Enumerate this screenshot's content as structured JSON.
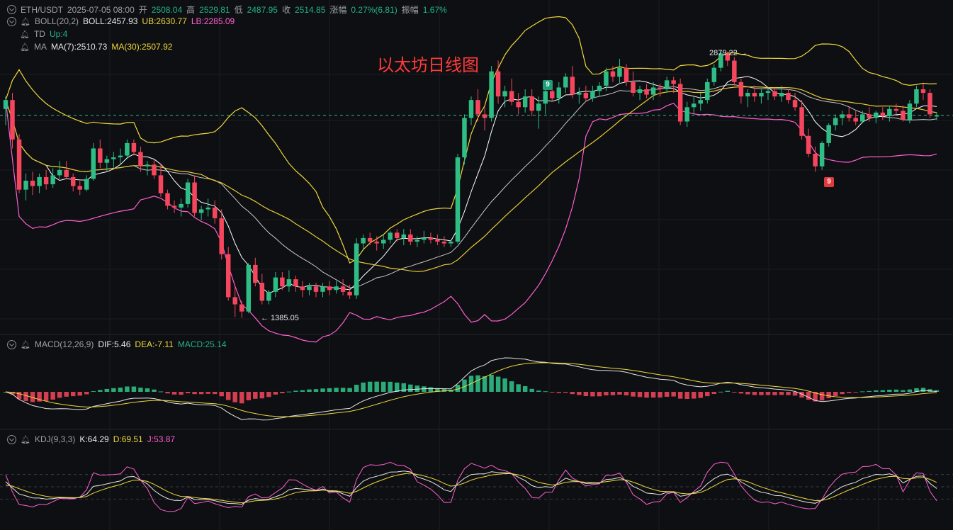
{
  "header": {
    "symbol": "ETH/USDT",
    "datetime": "2025-07-05 08:00",
    "open_label": "开",
    "open": "2508.04",
    "high_label": "高",
    "high": "2529.81",
    "low_label": "低",
    "low": "2487.95",
    "close_label": "收",
    "close": "2514.85",
    "change_label": "涨幅",
    "change": "0.27%(6.81)",
    "amp_label": "振幅",
    "amp": "1.67%"
  },
  "boll": {
    "name": "BOLL(20,2)",
    "mid": "BOLL:2457.93",
    "ub": "UB:2630.77",
    "lb": "LB:2285.09"
  },
  "td": {
    "name": "TD",
    "value": "Up:4"
  },
  "ma": {
    "name": "MA",
    "ma7": "MA(7):2510.73",
    "ma30": "MA(30):2507.92"
  },
  "macd": {
    "name": "MACD(12,26,9)",
    "dif": "DIF:5.46",
    "dea": "DEA:-7.11",
    "macd": "MACD:25.14"
  },
  "kdj": {
    "name": "KDJ(9,3,3)",
    "k": "K:64.29",
    "d": "D:69.51",
    "j": "J:53.87"
  },
  "title": "以太坊日线图",
  "annotations": {
    "high": "2879.22 →",
    "low": "← 1385.05",
    "td_top": "9",
    "td_bottom": "9"
  },
  "colors": {
    "up": "#2ebd85",
    "down": "#f6465d",
    "mid": "#e6e6e6",
    "ub": "#f0d83c",
    "lb": "#ff5fd1"
  },
  "chart_data": {
    "type": "candlestick",
    "symbol": "ETH/USDT",
    "interval": "1D",
    "ylim": [
      1300,
      3000
    ],
    "ohlc": [
      [
        2550,
        2620,
        2460,
        2600
      ],
      [
        2600,
        2640,
        2330,
        2380
      ],
      [
        2380,
        2410,
        2080,
        2100
      ],
      [
        2100,
        2190,
        2040,
        2150
      ],
      [
        2150,
        2200,
        2070,
        2120
      ],
      [
        2120,
        2190,
        2080,
        2170
      ],
      [
        2170,
        2210,
        2100,
        2130
      ],
      [
        2130,
        2220,
        2110,
        2180
      ],
      [
        2180,
        2260,
        2160,
        2210
      ],
      [
        2210,
        2260,
        2160,
        2170
      ],
      [
        2170,
        2190,
        2090,
        2120
      ],
      [
        2120,
        2150,
        2070,
        2100
      ],
      [
        2100,
        2180,
        2090,
        2160
      ],
      [
        2160,
        2360,
        2150,
        2330
      ],
      [
        2330,
        2380,
        2220,
        2250
      ],
      [
        2250,
        2290,
        2200,
        2270
      ],
      [
        2270,
        2310,
        2220,
        2280
      ],
      [
        2280,
        2330,
        2240,
        2290
      ],
      [
        2290,
        2380,
        2270,
        2360
      ],
      [
        2360,
        2380,
        2290,
        2310
      ],
      [
        2310,
        2340,
        2200,
        2230
      ],
      [
        2230,
        2260,
        2180,
        2240
      ],
      [
        2240,
        2270,
        2160,
        2180
      ],
      [
        2180,
        2240,
        2060,
        2080
      ],
      [
        2080,
        2100,
        1990,
        2010
      ],
      [
        2010,
        2040,
        1970,
        2000
      ],
      [
        2000,
        2050,
        1950,
        2020
      ],
      [
        2020,
        2160,
        2000,
        2140
      ],
      [
        2140,
        2180,
        1950,
        1970
      ],
      [
        1970,
        2010,
        1930,
        1990
      ],
      [
        1990,
        2050,
        1950,
        2000
      ],
      [
        2000,
        2040,
        1910,
        1940
      ],
      [
        1940,
        1990,
        1710,
        1740
      ],
      [
        1740,
        1780,
        1480,
        1500
      ],
      [
        1500,
        1560,
        1390,
        1460
      ],
      [
        1460,
        1480,
        1385.05,
        1420
      ],
      [
        1420,
        1690,
        1410,
        1680
      ],
      [
        1680,
        1720,
        1560,
        1580
      ],
      [
        1580,
        1630,
        1460,
        1480
      ],
      [
        1480,
        1540,
        1460,
        1530
      ],
      [
        1530,
        1640,
        1500,
        1610
      ],
      [
        1610,
        1640,
        1540,
        1560
      ],
      [
        1560,
        1650,
        1530,
        1600
      ],
      [
        1600,
        1620,
        1530,
        1560
      ],
      [
        1560,
        1590,
        1500,
        1540
      ],
      [
        1540,
        1580,
        1510,
        1560
      ],
      [
        1560,
        1580,
        1500,
        1530
      ],
      [
        1530,
        1580,
        1500,
        1560
      ],
      [
        1560,
        1590,
        1510,
        1540
      ],
      [
        1540,
        1590,
        1520,
        1560
      ],
      [
        1560,
        1600,
        1510,
        1530
      ],
      [
        1530,
        1570,
        1490,
        1510
      ],
      [
        1510,
        1830,
        1490,
        1800
      ],
      [
        1800,
        1850,
        1760,
        1830
      ],
      [
        1830,
        1860,
        1790,
        1810
      ],
      [
        1810,
        1840,
        1760,
        1800
      ],
      [
        1800,
        1850,
        1770,
        1820
      ],
      [
        1820,
        1870,
        1800,
        1860
      ],
      [
        1860,
        1880,
        1810,
        1830
      ],
      [
        1830,
        1880,
        1790,
        1850
      ],
      [
        1850,
        1880,
        1790,
        1810
      ],
      [
        1810,
        1840,
        1780,
        1820
      ],
      [
        1820,
        1870,
        1800,
        1830
      ],
      [
        1830,
        1860,
        1800,
        1820
      ],
      [
        1820,
        1850,
        1790,
        1810
      ],
      [
        1810,
        1840,
        1780,
        1800
      ],
      [
        1800,
        1820,
        1780,
        1810
      ],
      [
        1810,
        2300,
        1800,
        2280
      ],
      [
        2280,
        2520,
        2240,
        2500
      ],
      [
        2500,
        2620,
        2460,
        2600
      ],
      [
        2600,
        2660,
        2480,
        2520
      ],
      [
        2520,
        2560,
        2430,
        2500
      ],
      [
        2500,
        2790,
        2480,
        2760
      ],
      [
        2760,
        2820,
        2580,
        2620
      ],
      [
        2620,
        2680,
        2560,
        2650
      ],
      [
        2650,
        2720,
        2570,
        2590
      ],
      [
        2590,
        2640,
        2520,
        2560
      ],
      [
        2560,
        2660,
        2530,
        2620
      ],
      [
        2620,
        2660,
        2510,
        2540
      ],
      [
        2540,
        2620,
        2440,
        2580
      ],
      [
        2580,
        2680,
        2520,
        2650
      ],
      [
        2650,
        2680,
        2590,
        2610
      ],
      [
        2610,
        2700,
        2580,
        2670
      ],
      [
        2670,
        2750,
        2640,
        2730
      ],
      [
        2730,
        2790,
        2610,
        2630
      ],
      [
        2630,
        2670,
        2580,
        2640
      ],
      [
        2640,
        2680,
        2590,
        2610
      ],
      [
        2610,
        2680,
        2590,
        2650
      ],
      [
        2650,
        2700,
        2620,
        2680
      ],
      [
        2680,
        2780,
        2650,
        2760
      ],
      [
        2760,
        2790,
        2700,
        2730
      ],
      [
        2730,
        2830,
        2690,
        2780
      ],
      [
        2780,
        2800,
        2680,
        2700
      ],
      [
        2700,
        2760,
        2620,
        2640
      ],
      [
        2640,
        2680,
        2600,
        2660
      ],
      [
        2660,
        2690,
        2610,
        2630
      ],
      [
        2630,
        2700,
        2600,
        2670
      ],
      [
        2670,
        2690,
        2620,
        2660
      ],
      [
        2660,
        2730,
        2640,
        2710
      ],
      [
        2710,
        2730,
        2640,
        2690
      ],
      [
        2690,
        2720,
        2460,
        2480
      ],
      [
        2480,
        2590,
        2450,
        2560
      ],
      [
        2560,
        2620,
        2520,
        2580
      ],
      [
        2580,
        2640,
        2540,
        2600
      ],
      [
        2600,
        2720,
        2580,
        2700
      ],
      [
        2700,
        2800,
        2680,
        2780
      ],
      [
        2780,
        2879.22,
        2760,
        2860
      ],
      [
        2860,
        2870,
        2790,
        2820
      ],
      [
        2820,
        2840,
        2680,
        2700
      ],
      [
        2700,
        2720,
        2580,
        2620
      ],
      [
        2620,
        2660,
        2560,
        2640
      ],
      [
        2640,
        2680,
        2590,
        2620
      ],
      [
        2620,
        2660,
        2580,
        2640
      ],
      [
        2640,
        2670,
        2600,
        2650
      ],
      [
        2650,
        2670,
        2600,
        2620
      ],
      [
        2620,
        2680,
        2590,
        2640
      ],
      [
        2640,
        2660,
        2580,
        2600
      ],
      [
        2600,
        2640,
        2540,
        2560
      ],
      [
        2560,
        2600,
        2380,
        2400
      ],
      [
        2400,
        2440,
        2280,
        2300
      ],
      [
        2300,
        2340,
        2200,
        2230
      ],
      [
        2230,
        2370,
        2210,
        2360
      ],
      [
        2360,
        2470,
        2340,
        2460
      ],
      [
        2460,
        2520,
        2430,
        2500
      ],
      [
        2500,
        2540,
        2460,
        2520
      ],
      [
        2520,
        2560,
        2480,
        2500
      ],
      [
        2500,
        2540,
        2460,
        2480
      ],
      [
        2480,
        2540,
        2470,
        2520
      ],
      [
        2520,
        2560,
        2480,
        2500
      ],
      [
        2500,
        2540,
        2470,
        2530
      ],
      [
        2530,
        2560,
        2490,
        2510
      ],
      [
        2510,
        2570,
        2480,
        2550
      ],
      [
        2550,
        2580,
        2510,
        2540
      ],
      [
        2540,
        2570,
        2480,
        2490
      ],
      [
        2490,
        2600,
        2470,
        2580
      ],
      [
        2580,
        2680,
        2560,
        2660
      ],
      [
        2660,
        2690,
        2600,
        2640
      ],
      [
        2640,
        2660,
        2500,
        2520
      ],
      [
        2508.04,
        2529.81,
        2487.95,
        2514.85
      ]
    ]
  }
}
